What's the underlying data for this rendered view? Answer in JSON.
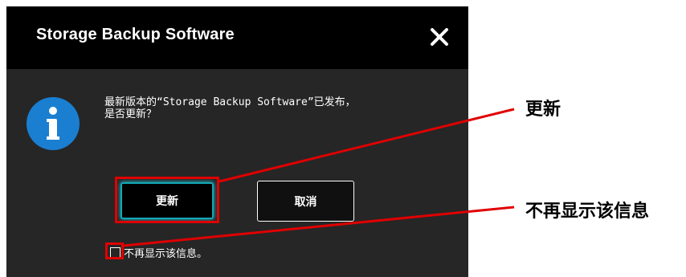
{
  "dialog": {
    "title": "Storage Backup Software",
    "message": "最新版本的“Storage Backup Software”已发布，\n是否更新？",
    "buttons": {
      "update": "更新",
      "cancel": "取消"
    },
    "checkbox": {
      "label": "不再显示该信息。",
      "checked": false
    },
    "icons": {
      "close": "close-icon",
      "info": "info-icon"
    }
  },
  "annotations": {
    "update": "更新",
    "dont_show": "不再显示该信息"
  },
  "colors": {
    "dialog_bg": "#262626",
    "titlebar_bg": "#000000",
    "info_blue": "#1a7fd1",
    "focus_teal": "#13a6b6",
    "callout_red": "#e00000"
  }
}
